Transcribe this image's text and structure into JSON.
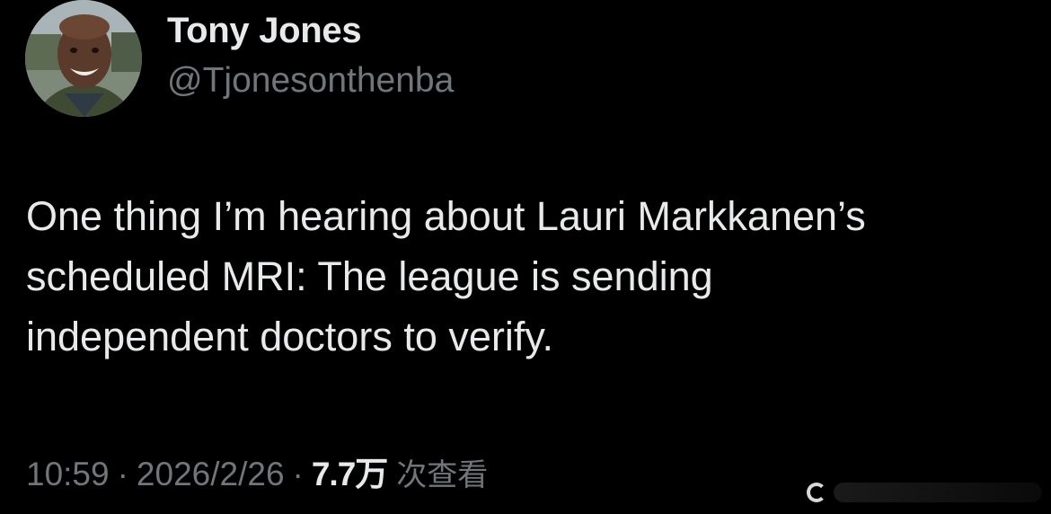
{
  "author": {
    "name": "Tony Jones",
    "handle": "@Tjonesonthenba",
    "avatar_icon": "profile-photo"
  },
  "tweet": {
    "lines": [
      "One thing I’m hearing about Lauri Markkanen’s",
      "scheduled MRI: The league is sending",
      "independent doctors to verify."
    ]
  },
  "meta": {
    "time": "10:59",
    "separator": "·",
    "date": "2026/2/26",
    "views_count": "7.7万",
    "views_label": "次查看"
  },
  "colors": {
    "background": "#000000",
    "primary_text": "#e7e9ea",
    "secondary_text": "#71767b"
  }
}
